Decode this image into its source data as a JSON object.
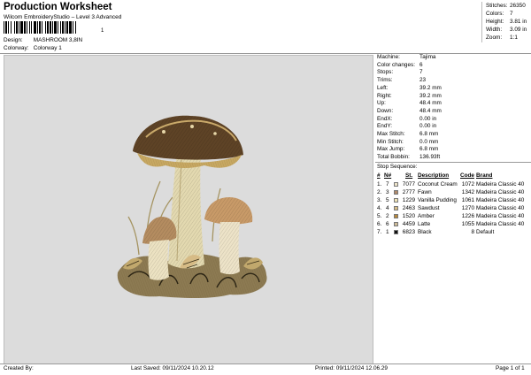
{
  "header": {
    "title": "Production Worksheet",
    "subtitle": "Wilcom EmbroideryStudio – Level 3 Advanced",
    "barcode_tail": "1",
    "design_label": "Design:",
    "design_value": "MASHROOM 3,8IN",
    "colorway_label": "Colorway:",
    "colorway_value": "Colorway 1"
  },
  "summary": [
    {
      "label": "Stitches:",
      "value": "26350"
    },
    {
      "label": "Colors:",
      "value": "7"
    },
    {
      "label": "Height:",
      "value": "3.81 in"
    },
    {
      "label": "Width:",
      "value": "3.09 in"
    },
    {
      "label": "Zoom:",
      "value": "1:1"
    }
  ],
  "machine_info": [
    {
      "label": "Machine:",
      "value": "Tajima"
    },
    {
      "label": "Color changes:",
      "value": "6"
    },
    {
      "label": "Stops:",
      "value": "7"
    },
    {
      "label": "Trims:",
      "value": "23"
    },
    {
      "label": "Left:",
      "value": "39.2 mm"
    },
    {
      "label": "Right:",
      "value": "39.2 mm"
    },
    {
      "label": "Up:",
      "value": "48.4 mm"
    },
    {
      "label": "Down:",
      "value": "48.4 mm"
    },
    {
      "label": "EndX:",
      "value": "0.00 in"
    },
    {
      "label": "EndY:",
      "value": "0.00 in"
    },
    {
      "label": "Max Stitch:",
      "value": "6.8 mm"
    },
    {
      "label": "Min Stitch:",
      "value": "0.0 mm"
    },
    {
      "label": "Max Jump:",
      "value": "6.8 mm"
    },
    {
      "label": "Total Bobbin:",
      "value": "136.93ft"
    }
  ],
  "stop_sequence": {
    "title": "Stop Sequence:",
    "columns": [
      "#",
      "N#",
      "St.",
      "Description",
      "Code",
      "Brand"
    ],
    "rows": [
      {
        "num": "1.",
        "needle": "7",
        "st": "7077",
        "description": "Coconut Cream",
        "code": "1072",
        "brand": "Madeira Classic 40",
        "color": "#ede3c8"
      },
      {
        "num": "2.",
        "needle": "3",
        "st": "2777",
        "description": "Fawn",
        "code": "1342",
        "brand": "Madeira Classic 40",
        "color": "#b08a6c"
      },
      {
        "num": "3.",
        "needle": "5",
        "st": "1229",
        "description": "Vanilla Pudding",
        "code": "1061",
        "brand": "Madeira Classic 40",
        "color": "#efe4b6"
      },
      {
        "num": "4.",
        "needle": "4",
        "st": "2463",
        "description": "Sawdust",
        "code": "1270",
        "brand": "Madeira Classic 40",
        "color": "#d6bb86"
      },
      {
        "num": "5.",
        "needle": "2",
        "st": "1520",
        "description": "Amber",
        "code": "1226",
        "brand": "Madeira Classic 40",
        "color": "#b7883c"
      },
      {
        "num": "6.",
        "needle": "6",
        "st": "4459",
        "description": "Latte",
        "code": "1055",
        "brand": "Madeira Classic 40",
        "color": "#cdbb97"
      },
      {
        "num": "7.",
        "needle": "1",
        "st": "6823",
        "description": "Black",
        "code": "8",
        "brand": "Default",
        "color": "#111111"
      }
    ]
  },
  "footer": {
    "created_by": "Created By:",
    "last_saved": "Last Saved: 09/11/2024 10.20.12",
    "printed": "Printed: 09/11/2024 12.06.29",
    "page": "Page 1 of 1"
  }
}
